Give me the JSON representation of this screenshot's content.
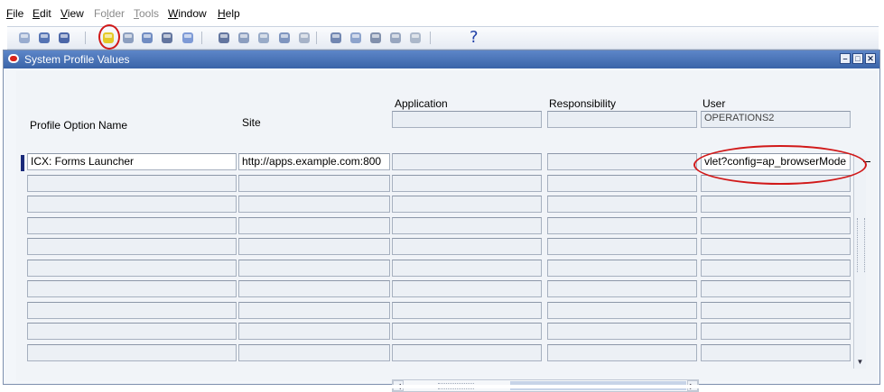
{
  "menu": {
    "items": [
      {
        "u": "F",
        "rest": "ile",
        "enabled": true
      },
      {
        "u": "E",
        "rest": "dit",
        "enabled": true
      },
      {
        "u": "V",
        "rest": "iew",
        "enabled": true
      },
      {
        "pre": "Fo",
        "u": "l",
        "rest": "der",
        "enabled": false
      },
      {
        "u": "T",
        "rest": "ools",
        "enabled": false
      },
      {
        "u": "W",
        "rest": "indow",
        "enabled": true
      },
      {
        "u": "H",
        "rest": "elp",
        "enabled": true
      }
    ]
  },
  "toolbar": {
    "icons": [
      "new-icon",
      "find-icon",
      "navigator-icon",
      "save-icon",
      "next-step-icon",
      "switch-responsibility-icon",
      "print-icon",
      "close-form-icon",
      "cut-icon",
      "copy-icon",
      "paste-icon",
      "new-record-icon",
      "delete-record-icon",
      "edit-field-icon",
      "zoom-icon",
      "translations-icon",
      "attachments-icon",
      "folder-tools-icon"
    ],
    "help_label": "?"
  },
  "window": {
    "title": "System Profile Values"
  },
  "headers": {
    "profile_option_name": "Profile Option Name",
    "site": "Site",
    "application": "Application",
    "responsibility": "Responsibility",
    "user": "User"
  },
  "context": {
    "user": "OPERATIONS2"
  },
  "rows": [
    {
      "name": "ICX: Forms Launcher",
      "site": "http://apps.example.com:800",
      "application": "",
      "responsibility": "",
      "user": "vlet?config=ap_browserMode"
    },
    {
      "name": "",
      "site": "",
      "application": "",
      "responsibility": "",
      "user": ""
    },
    {
      "name": "",
      "site": "",
      "application": "",
      "responsibility": "",
      "user": ""
    },
    {
      "name": "",
      "site": "",
      "application": "",
      "responsibility": "",
      "user": ""
    },
    {
      "name": "",
      "site": "",
      "application": "",
      "responsibility": "",
      "user": ""
    },
    {
      "name": "",
      "site": "",
      "application": "",
      "responsibility": "",
      "user": ""
    },
    {
      "name": "",
      "site": "",
      "application": "",
      "responsibility": "",
      "user": ""
    },
    {
      "name": "",
      "site": "",
      "application": "",
      "responsibility": "",
      "user": ""
    },
    {
      "name": "",
      "site": "",
      "application": "",
      "responsibility": "",
      "user": ""
    },
    {
      "name": "",
      "site": "",
      "application": "",
      "responsibility": "",
      "user": ""
    }
  ],
  "colors": {
    "annotation": "#d11919",
    "titlebar": "#3a64a8"
  }
}
